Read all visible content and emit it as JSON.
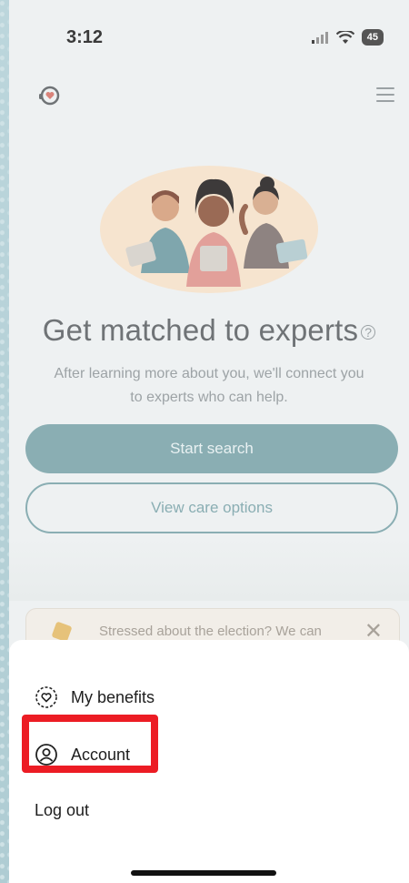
{
  "status_bar": {
    "time": "3:12",
    "battery": "45"
  },
  "hero": {
    "headline": "Get matched to experts",
    "subtitle_line1": "After learning more about you, we'll connect you",
    "subtitle_line2": "to experts who can help."
  },
  "actions": {
    "start_search": "Start search",
    "view_care_options": "View care options"
  },
  "banner": {
    "text": "Stressed about the election? We can",
    "close": "✕"
  },
  "menu_sheet": {
    "items": [
      {
        "label": "My benefits",
        "icon": "heart-badge-icon"
      },
      {
        "label": "Account",
        "icon": "user-circle-icon"
      },
      {
        "label": "Log out"
      }
    ]
  },
  "colors": {
    "primary": "#8aaeb3",
    "highlight": "#ec1c24"
  }
}
